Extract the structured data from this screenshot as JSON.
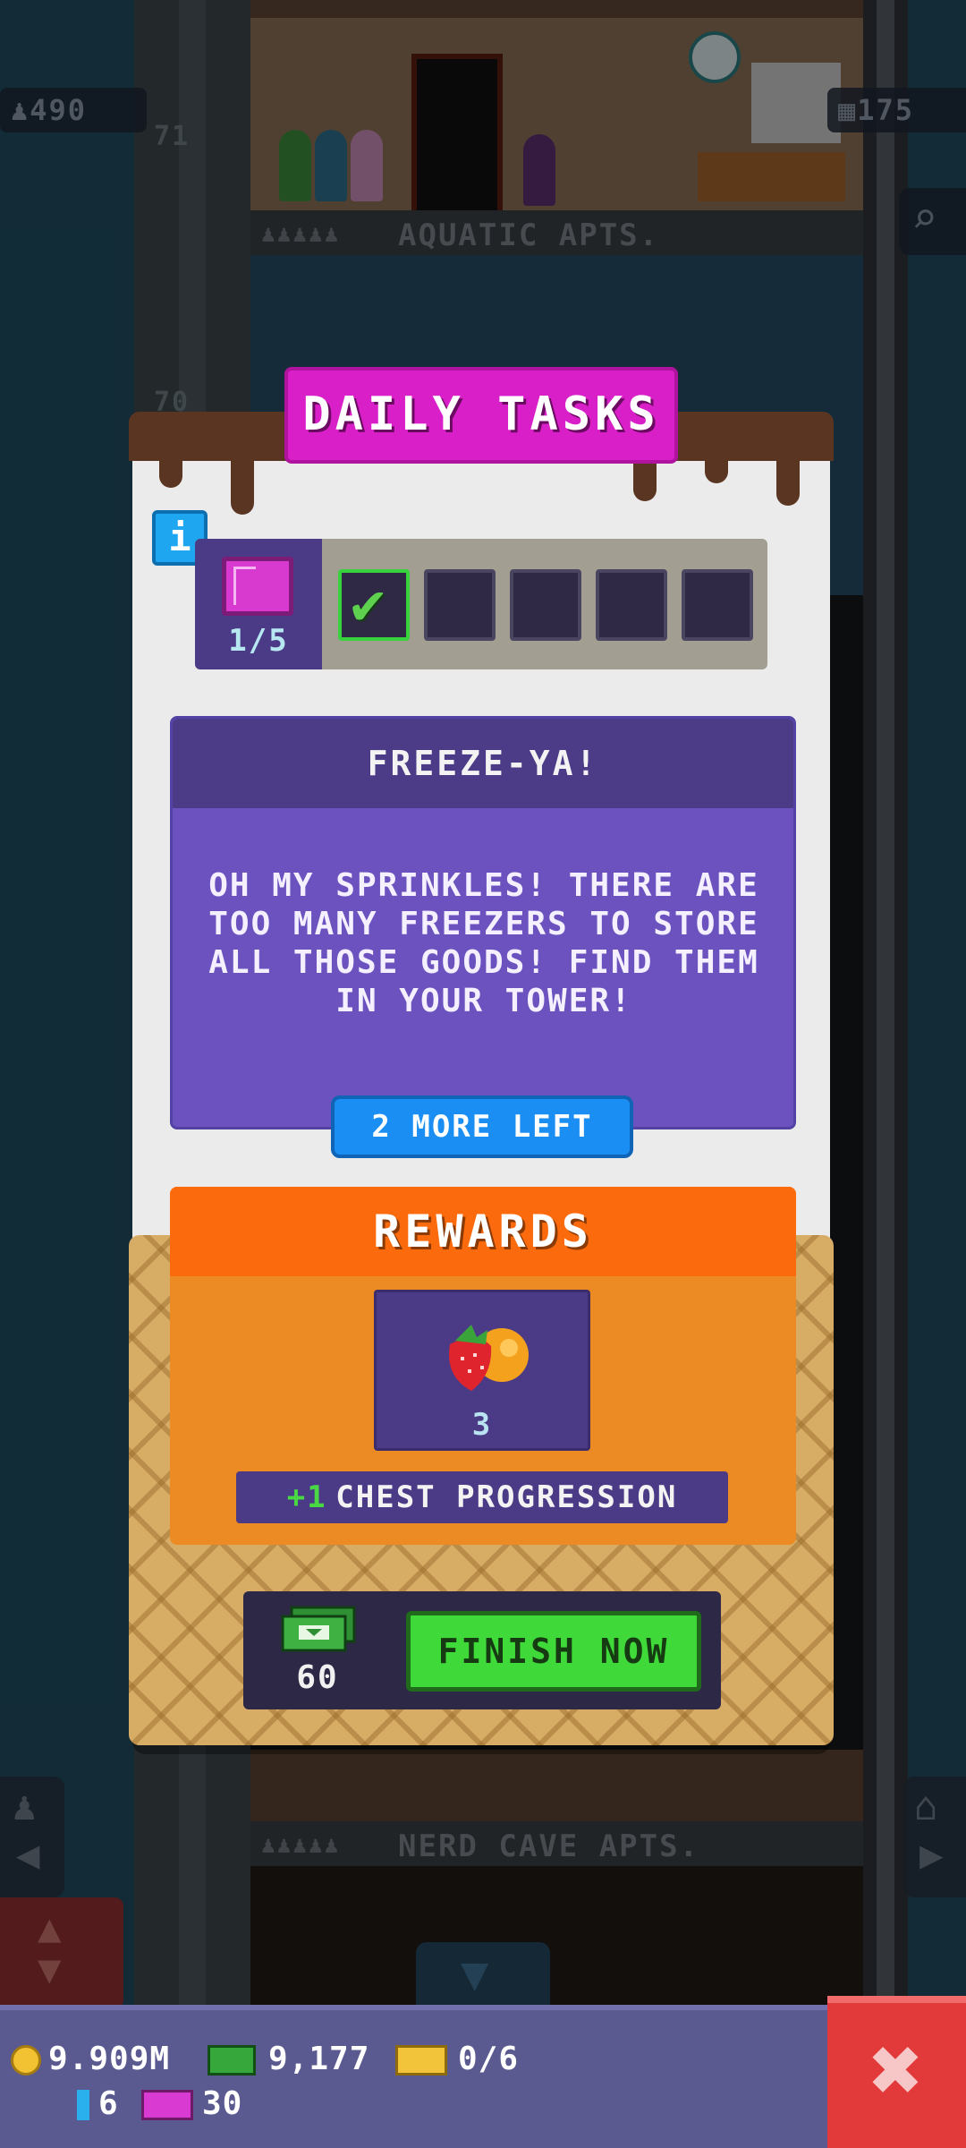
{
  "dialog": {
    "title": "DAILY TASKS",
    "info_icon": "i",
    "progress": {
      "label": "1/5",
      "completed": 1,
      "total": 5
    },
    "task": {
      "title": "FREEZE-YA!",
      "description": "OH MY SPRINKLES! THERE ARE TOO MANY FREEZERS TO STORE ALL THOSE GOODS! FIND THEM IN YOUR TOWER!"
    },
    "remaining_label": "2 MORE LEFT",
    "rewards": {
      "title": "REWARDS",
      "item": {
        "icon": "fruit-icon",
        "quantity": "3"
      },
      "chest_progression_plus": "+1",
      "chest_progression_label": "CHEST PROGRESSION"
    },
    "finish": {
      "cost": "60",
      "button_label": "FINISH NOW",
      "icon": "bux-icon"
    }
  },
  "tower": {
    "population": "490",
    "floor_count": "175",
    "floors": [
      {
        "name": "AQUATIC APTS."
      },
      {
        "name": "NERD CAVE APTS."
      }
    ],
    "faded_numbers": [
      "71",
      "70"
    ]
  },
  "resources": {
    "coins": "9.909M",
    "bux": "9,177",
    "tickets": "0/6",
    "keys": "6",
    "vip": "30"
  },
  "colors": {
    "title_badge": "#d81fc8",
    "task_card": "#6b52be",
    "rewards_header": "#fb6a0c",
    "finish_button": "#3fd93a",
    "close_button": "#e23a3a",
    "hud_bar": "#5a5990"
  }
}
